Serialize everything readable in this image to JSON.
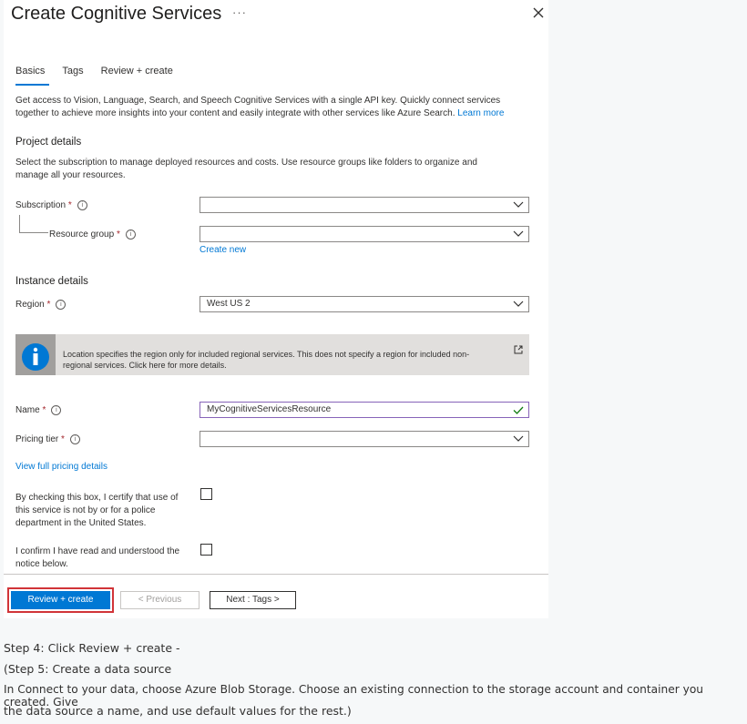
{
  "header": {
    "title": "Create Cognitive Services",
    "more": "···"
  },
  "tabs": [
    {
      "label": "Basics",
      "active": true
    },
    {
      "label": "Tags",
      "active": false
    },
    {
      "label": "Review + create",
      "active": false
    }
  ],
  "intro": {
    "line1": "Get access to Vision, Language, Search, and Speech Cognitive Services with a single API key. Quickly connect services",
    "line2": "together to achieve more insights into your content and easily integrate with other services like Azure Search.",
    "learn_more": "Learn more"
  },
  "project_details": {
    "heading": "Project details",
    "desc1": "Select the subscription to manage deployed resources and costs. Use resource groups like folders to organize and",
    "desc2": "manage all your resources.",
    "subscription_label": "Subscription",
    "subscription_value": "",
    "resource_group_label": "Resource group",
    "resource_group_value": "",
    "create_new": "Create new"
  },
  "instance_details": {
    "heading": "Instance details",
    "region_label": "Region",
    "region_value": "West US 2"
  },
  "info_banner": {
    "line1": "Location specifies the region only for included regional services. This does not specify a region for included non-",
    "line2": "regional services. Click here for more details."
  },
  "name_field": {
    "label": "Name",
    "value": "MyCognitiveServicesResource"
  },
  "pricing": {
    "label": "Pricing tier",
    "value": "",
    "view_details": "View full pricing details"
  },
  "certify": {
    "line1": "By checking this box, I certify that use of",
    "line2": "this service is not by or for a police",
    "line3": "department in the United States."
  },
  "confirm": {
    "line1": "I confirm I have read and understood the",
    "line2": "notice below."
  },
  "required_mark": "*",
  "footer": {
    "review_create": "Review + create",
    "previous": "< Previous",
    "next": "Next : Tags >"
  },
  "caption": {
    "step4": "Step 4: Click Review + create -",
    "step5": "(Step 5: Create a data source",
    "line3": "In Connect to your data, choose Azure Blob Storage. Choose an existing connection to the storage account and container you created. Give",
    "line4": "the data source a name, and use default values for the rest.)"
  },
  "colors": {
    "accent": "#0078d4",
    "highlight": "#d13438",
    "required": "#a4262c"
  }
}
